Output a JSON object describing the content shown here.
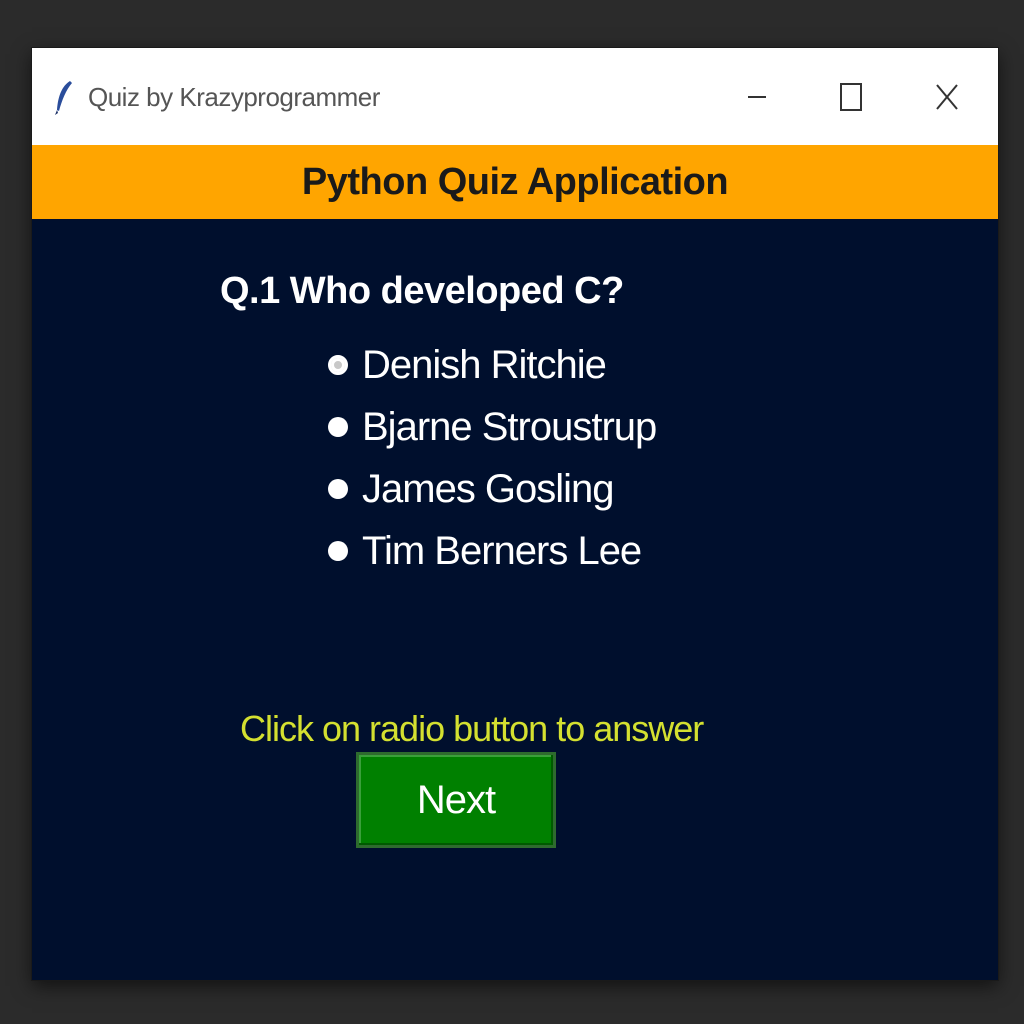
{
  "window": {
    "title": "Quiz by Krazyprogrammer",
    "icon": "feather-icon",
    "controls": [
      "minimize-icon",
      "maximize-icon",
      "close-icon"
    ]
  },
  "header": {
    "title": "Python Quiz Application",
    "background": "#ffa500"
  },
  "quiz": {
    "question": "Q.1 Who developed C?",
    "options": [
      {
        "label": "Denish Ritchie",
        "selected": true
      },
      {
        "label": "Bjarne Stroustrup",
        "selected": false
      },
      {
        "label": "James Gosling",
        "selected": false
      },
      {
        "label": "Tim Berners Lee",
        "selected": false
      }
    ],
    "hint": "Click on radio button to answer",
    "next_label": "Next"
  },
  "colors": {
    "body_background": "#000f2d",
    "hint_text": "#d4e030",
    "next_button": "#008000"
  }
}
